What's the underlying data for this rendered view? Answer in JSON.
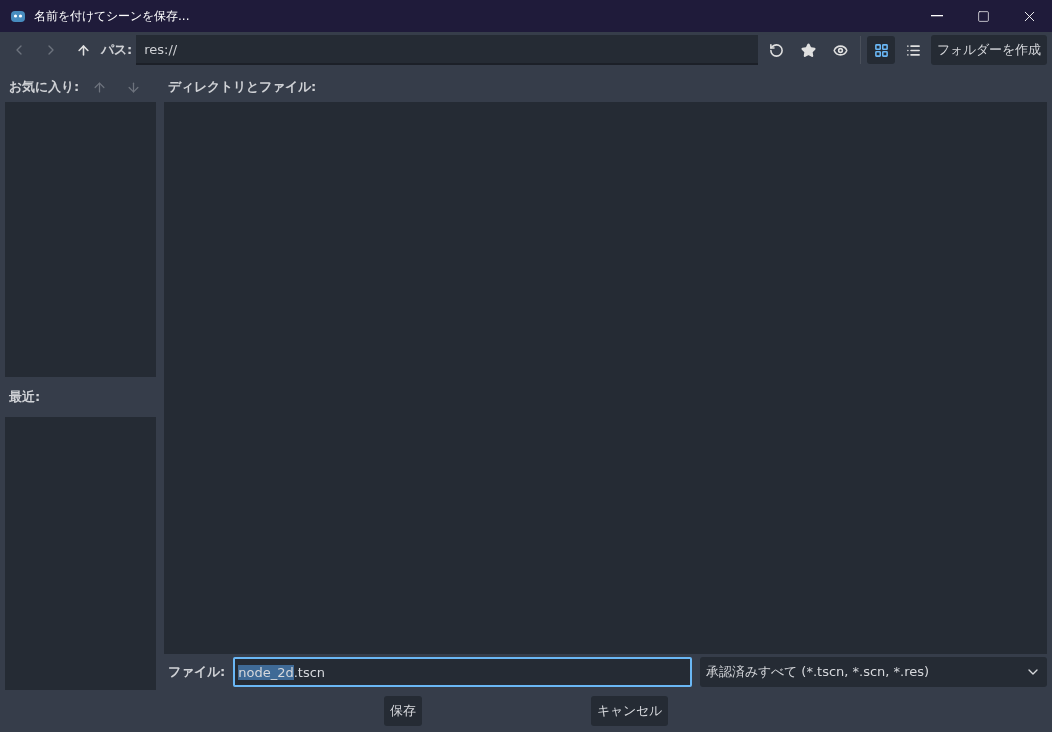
{
  "window": {
    "title": "名前を付けてシーンを保存..."
  },
  "toolbar": {
    "back": {
      "disabled": true
    },
    "forward": {
      "disabled": true
    },
    "path_label": "パス:",
    "path": "res://",
    "view_modes": [
      {
        "kind": "grid",
        "selected": true
      },
      {
        "kind": "list",
        "selected": false
      }
    ],
    "create_folder": "フォルダーを作成"
  },
  "favorites": {
    "label": "お気に入り:",
    "move_up": {
      "disabled": true
    },
    "move_down": {
      "disabled": true
    }
  },
  "recent": {
    "label": "最近:"
  },
  "files": {
    "label": "ディレクトリとファイル:"
  },
  "file_row": {
    "label": "ファイル:",
    "value_selected": "node_2d",
    "value_rest": ".tscn",
    "filter": "承認済みすべて (*.tscn, *.scn, *.res)"
  },
  "buttons": [
    "保存",
    "キャンセル"
  ]
}
